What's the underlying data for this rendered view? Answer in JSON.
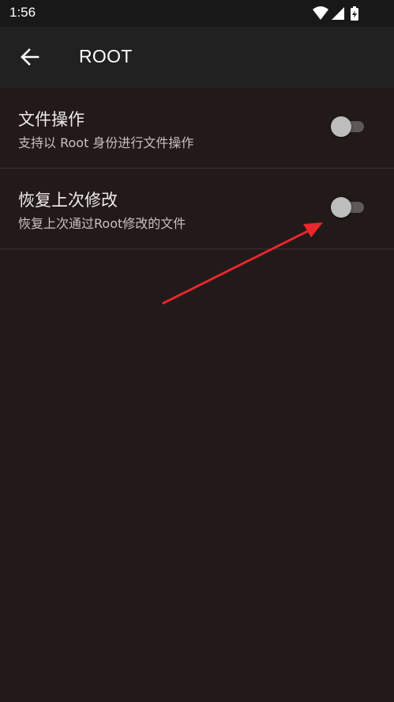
{
  "status_bar": {
    "time": "1:56",
    "icons": [
      "wifi-icon",
      "cell-signal-icon",
      "battery-charging-icon"
    ]
  },
  "app_bar": {
    "title": "ROOT",
    "back_icon": "arrow-back-icon"
  },
  "settings": [
    {
      "title": "文件操作",
      "subtitle": "支持以 Root 身份进行文件操作",
      "enabled": false
    },
    {
      "title": "恢复上次修改",
      "subtitle": "恢复上次通过Root修改的文件",
      "enabled": false
    }
  ],
  "annotation": {
    "type": "red-arrow",
    "color": "#e8262b",
    "points_to": "restore-last-modification-switch"
  },
  "colors": {
    "background": "#211a19",
    "app_bar": "#212121",
    "status_bar": "#181818",
    "switch_thumb_off": "#bdbdbd",
    "switch_track_off": "#5e5857"
  }
}
